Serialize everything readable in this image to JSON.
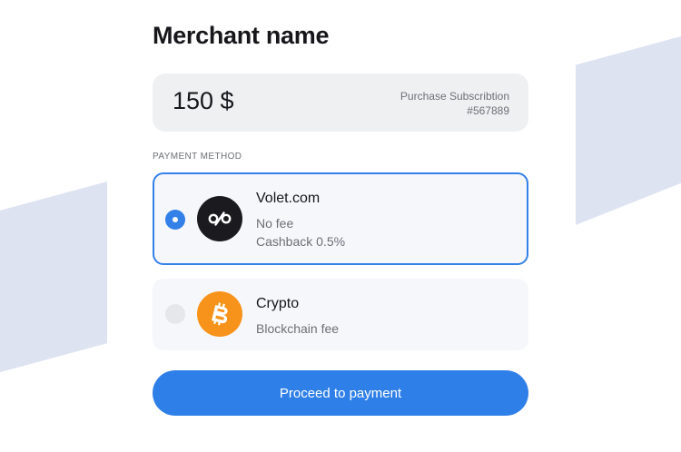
{
  "merchant": {
    "name": "Merchant name"
  },
  "order": {
    "amount": "150 $",
    "purchase_label": "Purchase Subscribtion",
    "order_id": "#567889"
  },
  "payment": {
    "section_label": "PAYMENT METHOD",
    "methods": [
      {
        "name": "Volet.com",
        "icon": "volet-logo-icon",
        "logo_text": "%",
        "details": [
          "No fee",
          "Cashback 0.5%"
        ],
        "selected": true
      },
      {
        "name": "Crypto",
        "icon": "bitcoin-icon",
        "details": [
          "Blockchain fee"
        ],
        "selected": false
      }
    ]
  },
  "actions": {
    "proceed_label": "Proceed to payment"
  },
  "colors": {
    "accent": "#3380e8",
    "button": "#2f7fe8",
    "bitcoin": "#f7931a",
    "decoration": "#dde3f1"
  }
}
